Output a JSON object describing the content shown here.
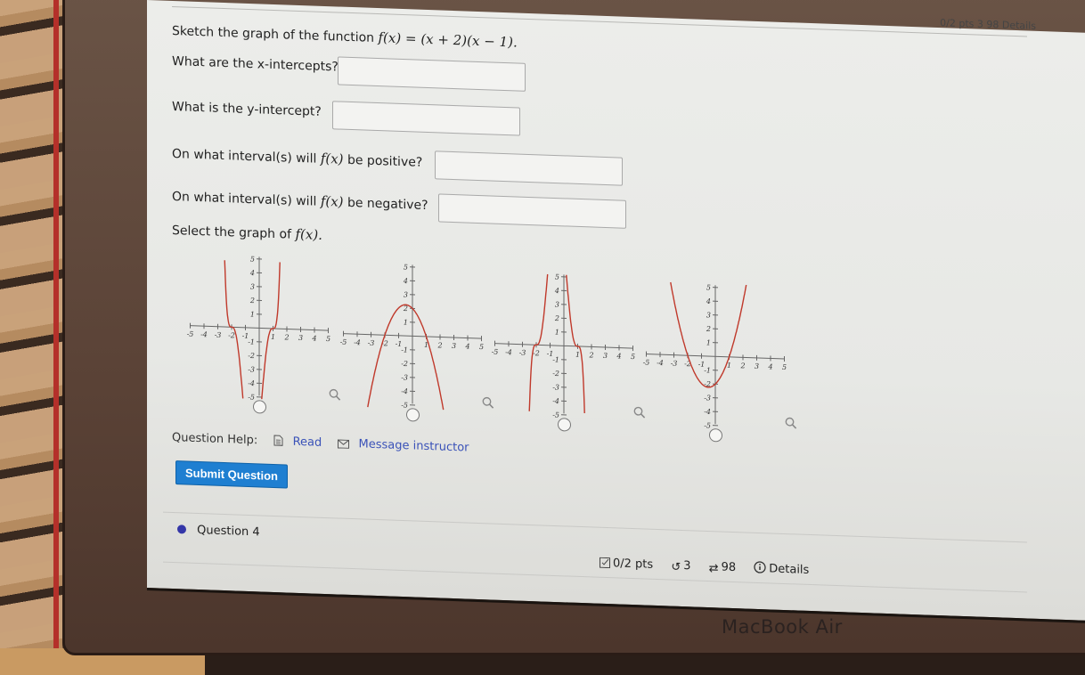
{
  "question": {
    "prompt_prefix": "Sketch the graph of the function",
    "function_math": "f(x) = (x + 2)(x − 1).",
    "items": [
      {
        "label": "What are the x-intercepts?",
        "value": ""
      },
      {
        "label": "What is the y-intercept?",
        "value": ""
      },
      {
        "label_prefix": "On what interval(s) will",
        "label_math": "f(x)",
        "label_suffix": "be positive?",
        "value": ""
      },
      {
        "label_prefix": "On what interval(s) will",
        "label_math": "f(x)",
        "label_suffix": "be negative?",
        "value": ""
      }
    ],
    "select_prefix": "Select the graph of",
    "select_math": "f(x)."
  },
  "graphs": {
    "curve_color": "#c0392b",
    "ticks": [
      "-5",
      "-4",
      "-3",
      "-2",
      "-1",
      "1",
      "2",
      "3",
      "4",
      "5"
    ],
    "options": [
      {
        "id": "A",
        "description": "quartic-like, up at both ends, deep negative between -2 and 1, flattening at roots"
      },
      {
        "id": "B",
        "description": "downward parabola, roots -2 and 1, vertex near (-0.5, 2.25)"
      },
      {
        "id": "C",
        "description": "cubic-like, negative at far left, positive between -2 and 1, negative right of 1"
      },
      {
        "id": "D",
        "description": "upward parabola, roots -2 and 1, vertex near (-0.5, -2.25)"
      }
    ]
  },
  "help": {
    "label": "Question Help:",
    "read": "Read",
    "message": "Message instructor"
  },
  "submit_label": "Submit Question",
  "next_question": {
    "title": "Question 4",
    "points": "0/2 pts",
    "retries": "3",
    "attempts": "98",
    "details": "Details"
  },
  "top_meta": "0/2 pts  3  98  Details",
  "device_brand": "MacBook Air"
}
